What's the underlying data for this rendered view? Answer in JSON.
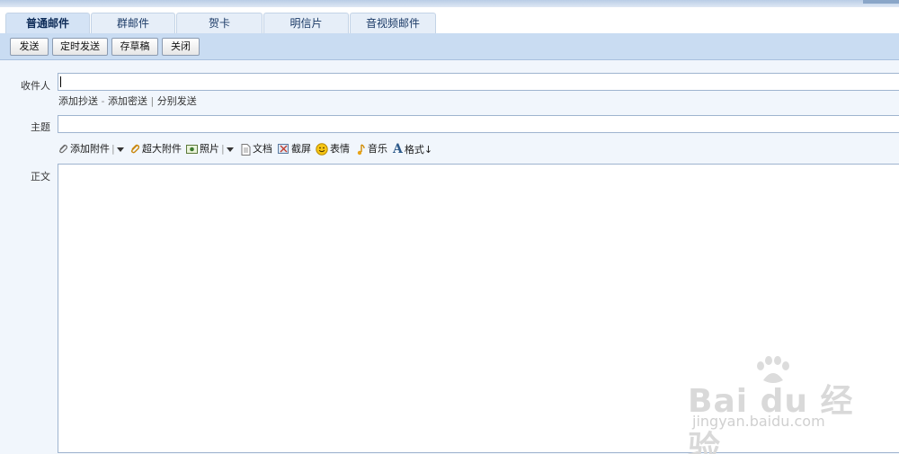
{
  "tabs": [
    {
      "label": "普通邮件",
      "active": true
    },
    {
      "label": "群邮件",
      "active": false
    },
    {
      "label": "贺卡",
      "active": false
    },
    {
      "label": "明信片",
      "active": false
    },
    {
      "label": "音视频邮件",
      "active": false
    }
  ],
  "toolbar": {
    "send_label": "发送",
    "scheduled_send_label": "定时发送",
    "save_draft_label": "存草稿",
    "close_label": "关闭"
  },
  "form": {
    "recipient_label": "收件人",
    "recipient_value": "",
    "add_cc": "添加抄送",
    "dash": "-",
    "add_bcc": "添加密送",
    "divider": "|",
    "separate_send": "分别发送",
    "subject_label": "主题",
    "subject_value": "",
    "body_label": "正文",
    "body_value": ""
  },
  "attach_bar": {
    "add_attachment": "添加附件",
    "large_attachment": "超大附件",
    "photo": "照片",
    "document": "文档",
    "screenshot": "截屏",
    "emoticon": "表情",
    "music": "音乐",
    "format": "格式↓",
    "icons": [
      "paperclip-icon",
      "paperclip-large-icon",
      "photo-icon",
      "document-icon",
      "screenshot-icon",
      "emoticon-icon",
      "music-icon",
      "format-icon"
    ]
  },
  "watermark": {
    "brand": "Bai du 经验",
    "url": "jingyan.baidu.com"
  },
  "colors": {
    "toolbar_bg": "#c9dcf2",
    "tab_active_bg": "#d4e3f5",
    "form_bg": "#f1f6fc",
    "field_border": "#9fb4cf"
  }
}
